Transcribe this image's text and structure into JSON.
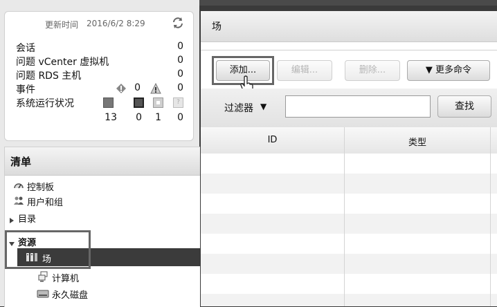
{
  "summary": {
    "update_label": "更新时间",
    "update_value": "2016/6/2 8:29",
    "rows": [
      {
        "label": "会话",
        "value": "0"
      },
      {
        "label": "问题 vCenter 虚拟机",
        "value": "0"
      },
      {
        "label": "问题 RDS 主机",
        "value": "0"
      },
      {
        "label": "事件",
        "value": "0"
      }
    ],
    "events_error_count": "0",
    "events_warning_count": "0",
    "health_label": "系统运行状况",
    "health_counts": [
      "13",
      "0",
      "1",
      "0"
    ]
  },
  "inventory": {
    "title": "清单",
    "items": [
      {
        "label": "控制板",
        "icon": "dashboard-icon"
      },
      {
        "label": "用户和组",
        "icon": "users-groups-icon"
      },
      {
        "label": "目录",
        "icon": "triangle-right-icon"
      },
      {
        "label": "资源",
        "icon": "triangle-down-icon"
      },
      {
        "label": "场",
        "icon": "farm-icon"
      },
      {
        "label": "计算机",
        "icon": "computer-icon"
      },
      {
        "label": "永久磁盘",
        "icon": "disk-icon"
      }
    ]
  },
  "main": {
    "title": "场",
    "toolbar": {
      "add": "添加...",
      "edit": "编辑...",
      "delete": "删除...",
      "more": "▼ 更多命令"
    },
    "filter": {
      "label": "过滤器",
      "arrow": "▼",
      "value": "",
      "search": "查找"
    },
    "columns": [
      "ID",
      "类型"
    ]
  },
  "colors": {
    "selected_row": "#3b3b3b",
    "highlight_border": "#666666"
  }
}
